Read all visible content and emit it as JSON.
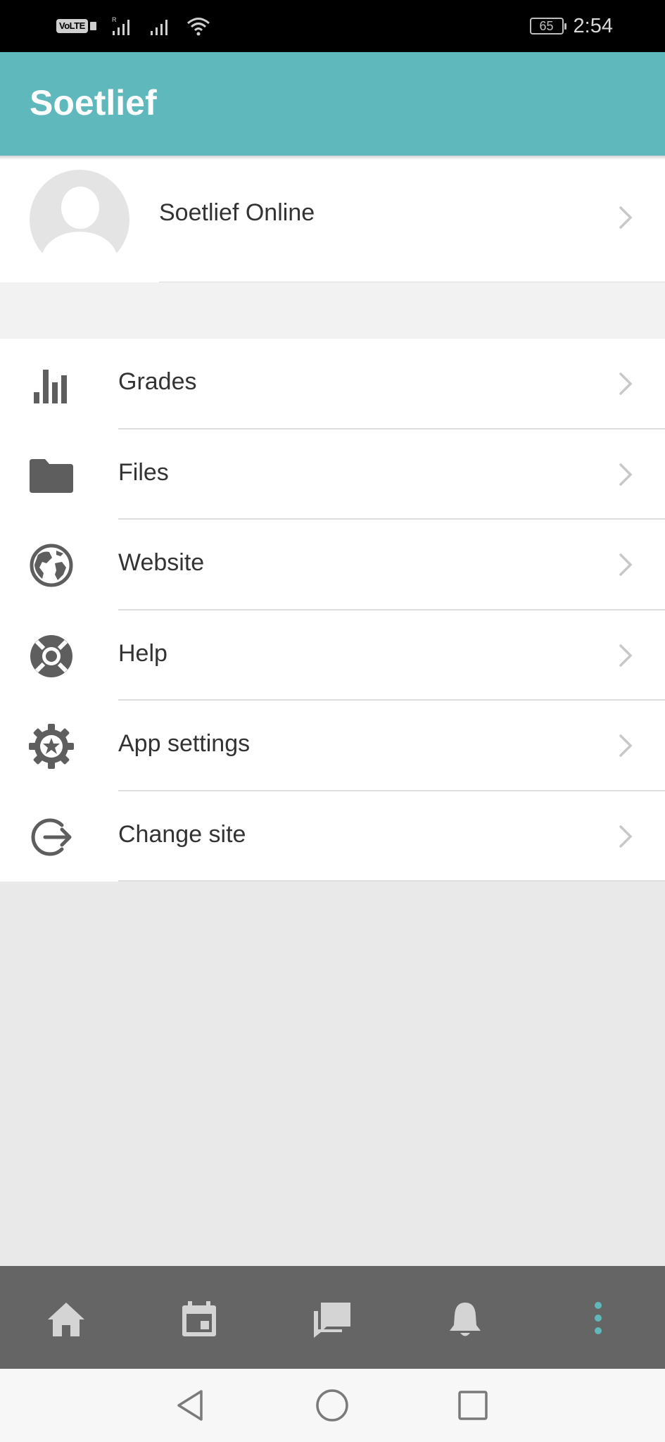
{
  "status_bar": {
    "network_label": "VoLTE",
    "battery": "65",
    "time": "2:54"
  },
  "app_bar": {
    "title": "Soetlief"
  },
  "profile": {
    "name": "Soetlief Online",
    "avatar_icon": "default-user-avatar"
  },
  "menu": {
    "items": [
      {
        "label": "Grades",
        "icon": "bar-chart-icon"
      },
      {
        "label": "Files",
        "icon": "folder-icon"
      },
      {
        "label": "Website",
        "icon": "globe-icon"
      },
      {
        "label": "Help",
        "icon": "life-ring-icon"
      },
      {
        "label": "App settings",
        "icon": "gear-icon"
      },
      {
        "label": "Change site",
        "icon": "sign-out-icon"
      }
    ]
  },
  "tab_bar": {
    "tabs": [
      {
        "icon": "home-icon"
      },
      {
        "icon": "calendar-icon"
      },
      {
        "icon": "messages-icon"
      },
      {
        "icon": "bell-icon"
      },
      {
        "icon": "more-vertical-icon",
        "active": true
      }
    ]
  },
  "colors": {
    "accent": "#5fb8bb",
    "tab_bar_bg": "#656565",
    "icon_gray": "#5e5e5e",
    "chevron_gray": "#c8c8c8"
  }
}
